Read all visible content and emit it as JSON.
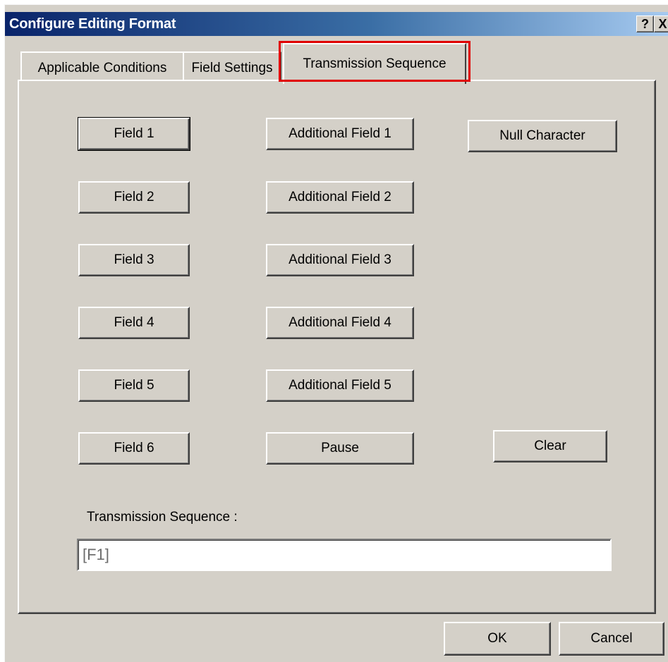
{
  "window": {
    "title": "Configure Editing Format",
    "help_label": "?",
    "close_label": "X"
  },
  "tabs": [
    {
      "label": "Applicable Conditions",
      "active": false
    },
    {
      "label": "Field Settings",
      "active": false
    },
    {
      "label": "Transmission Sequence",
      "active": true
    }
  ],
  "buttons": {
    "field_1": "Field 1",
    "field_2": "Field 2",
    "field_3": "Field 3",
    "field_4": "Field 4",
    "field_5": "Field 5",
    "field_6": "Field 6",
    "additional_field_1": "Additional Field 1",
    "additional_field_2": "Additional Field 2",
    "additional_field_3": "Additional Field 3",
    "additional_field_4": "Additional Field 4",
    "additional_field_5": "Additional Field 5",
    "pause": "Pause",
    "null_character": "Null Character",
    "clear": "Clear"
  },
  "sequence": {
    "label": "Transmission Sequence :",
    "value": "[F1]"
  },
  "footer": {
    "ok_label": "OK",
    "cancel_label": "Cancel"
  },
  "colors": {
    "titlebar_start": "#0a246a",
    "dialog_face": "#d4d0c8",
    "highlight": "#e00000"
  }
}
